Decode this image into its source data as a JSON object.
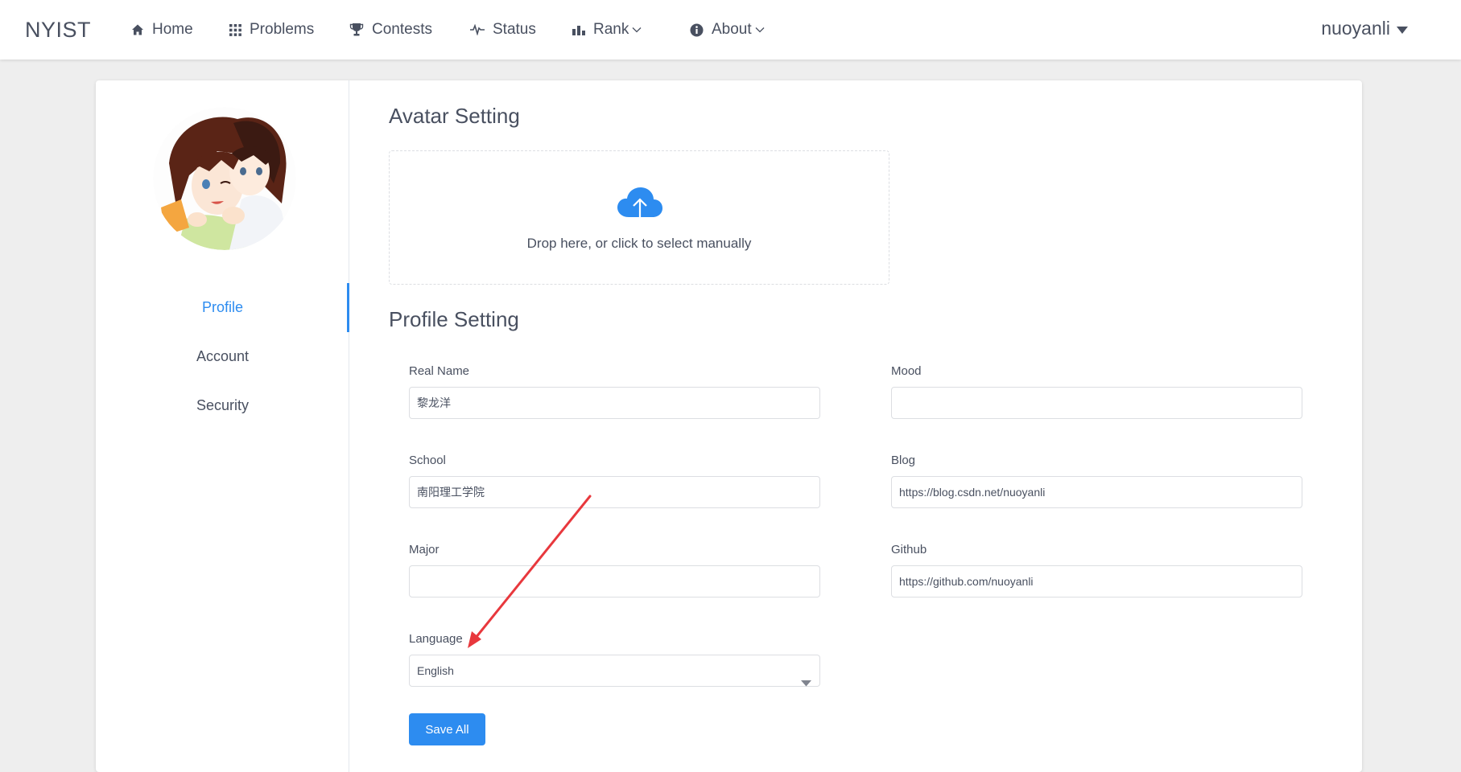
{
  "header": {
    "brand": "NYIST",
    "nav": [
      {
        "label": "Home",
        "icon": "home-icon"
      },
      {
        "label": "Problems",
        "icon": "grid-icon"
      },
      {
        "label": "Contests",
        "icon": "trophy-icon"
      },
      {
        "label": "Status",
        "icon": "pulse-icon"
      },
      {
        "label": "Rank",
        "icon": "bar-chart-icon",
        "dropdown": true
      },
      {
        "label": "About",
        "icon": "info-icon",
        "dropdown": true
      }
    ],
    "username": "nuoyanli"
  },
  "sidebar": {
    "items": [
      {
        "label": "Profile",
        "active": true
      },
      {
        "label": "Account",
        "active": false
      },
      {
        "label": "Security",
        "active": false
      }
    ]
  },
  "avatar_section": {
    "title": "Avatar Setting",
    "upload_hint": "Drop here, or click to select manually"
  },
  "profile_section": {
    "title": "Profile Setting",
    "fields": {
      "real_name": {
        "label": "Real Name",
        "value": "黎龙洋"
      },
      "mood": {
        "label": "Mood",
        "value": ""
      },
      "school": {
        "label": "School",
        "value": "南阳理工学院"
      },
      "blog": {
        "label": "Blog",
        "value": "https://blog.csdn.net/nuoyanli"
      },
      "major": {
        "label": "Major",
        "value": ""
      },
      "github": {
        "label": "Github",
        "value": "https://github.com/nuoyanli"
      },
      "language": {
        "label": "Language",
        "value": "English"
      }
    },
    "save_label": "Save All"
  },
  "colors": {
    "accent": "#2d8cf0",
    "text": "#495060",
    "background": "#eeeeee",
    "annotation_arrow": "#e8383d"
  }
}
